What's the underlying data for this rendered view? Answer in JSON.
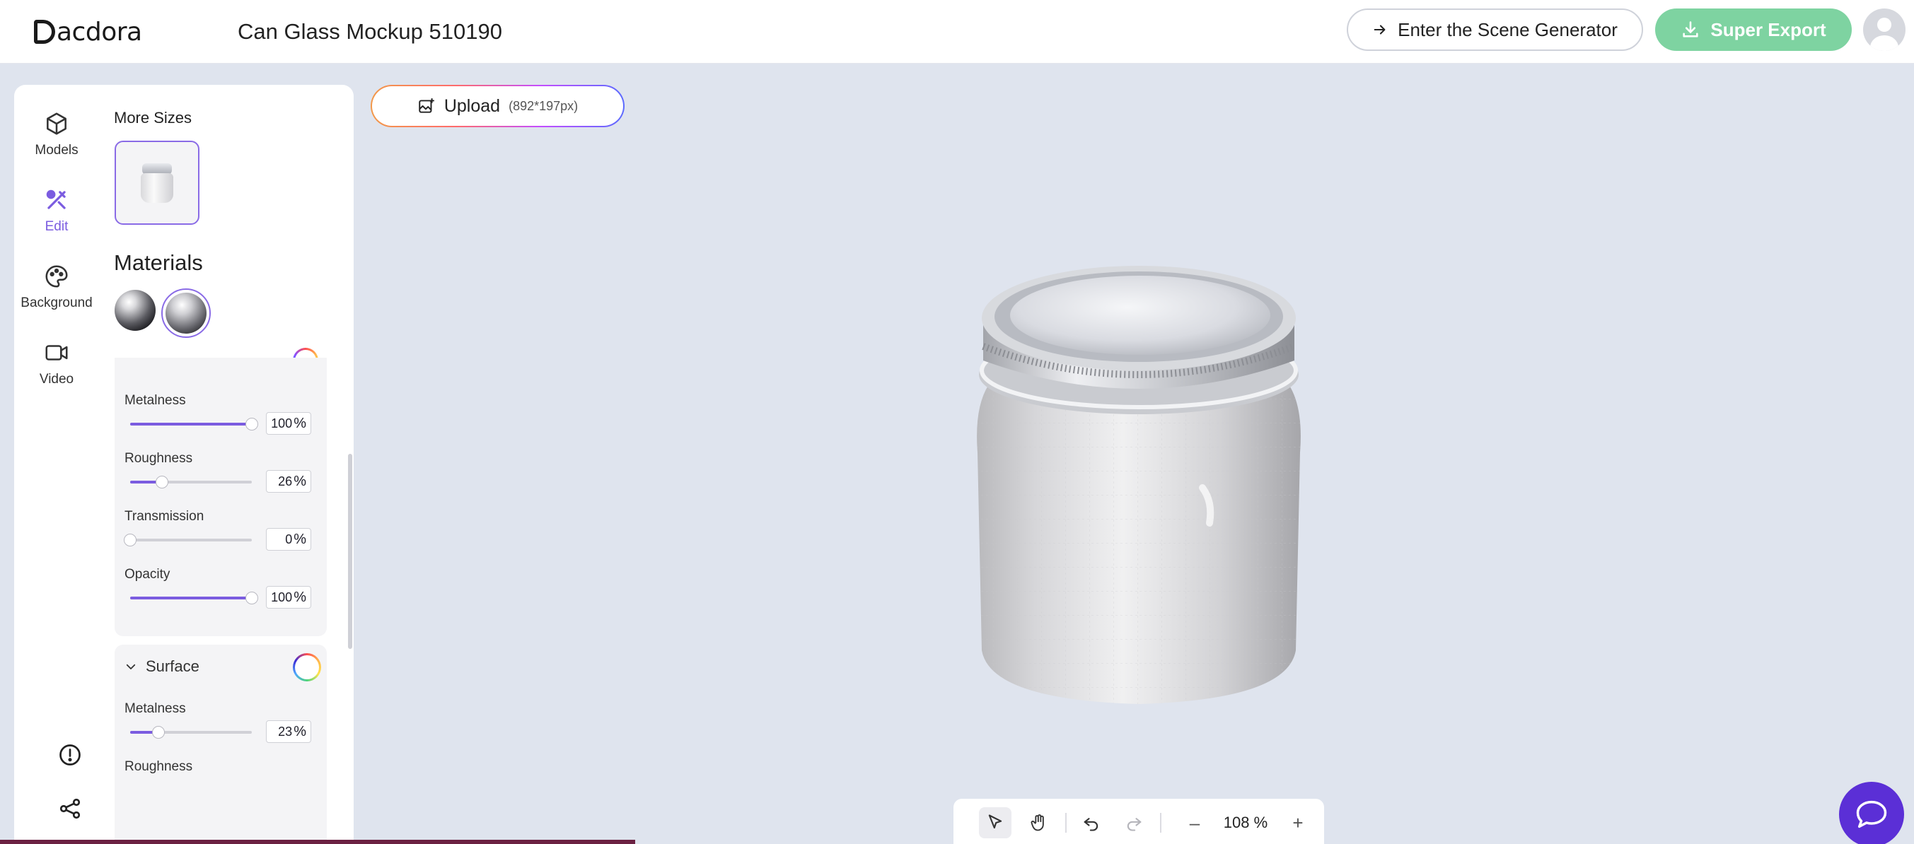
{
  "app": {
    "logo_text": "acdora",
    "document_title": "Can Glass Mockup 510190"
  },
  "header": {
    "scene_button": "Enter the Scene Generator",
    "export_button": "Super Export"
  },
  "sidebar": {
    "items": [
      {
        "label": "Models",
        "icon": "cube-icon"
      },
      {
        "label": "Edit",
        "icon": "edit-icon",
        "active": true
      },
      {
        "label": "Background",
        "icon": "palette-icon"
      },
      {
        "label": "Video",
        "icon": "video-icon"
      }
    ]
  },
  "panel": {
    "more_sizes_label": "More Sizes",
    "materials_title": "Materials",
    "properties": [
      {
        "label": "Metalness",
        "value": "100",
        "unit": "%",
        "fraction": 1.0
      },
      {
        "label": "Roughness",
        "value": "26",
        "unit": "%",
        "fraction": 0.26
      },
      {
        "label": "Transmission",
        "value": "0",
        "unit": "%",
        "fraction": 0.0
      },
      {
        "label": "Opacity",
        "value": "100",
        "unit": "%",
        "fraction": 1.0
      }
    ],
    "surface": {
      "title": "Surface",
      "properties": [
        {
          "label": "Metalness",
          "value": "23",
          "unit": "%",
          "fraction": 0.23
        },
        {
          "label": "Roughness"
        }
      ]
    }
  },
  "canvas": {
    "upload_label": "Upload",
    "upload_size": "(892*197px)",
    "zoom": "108 %",
    "zoom_minus": "–",
    "zoom_plus": "+"
  },
  "colors": {
    "accent": "#7b5ce0",
    "export_green": "#7ed3a1",
    "chat_purple": "#5b2fd6",
    "canvas_bg": "#dfe4ee"
  }
}
